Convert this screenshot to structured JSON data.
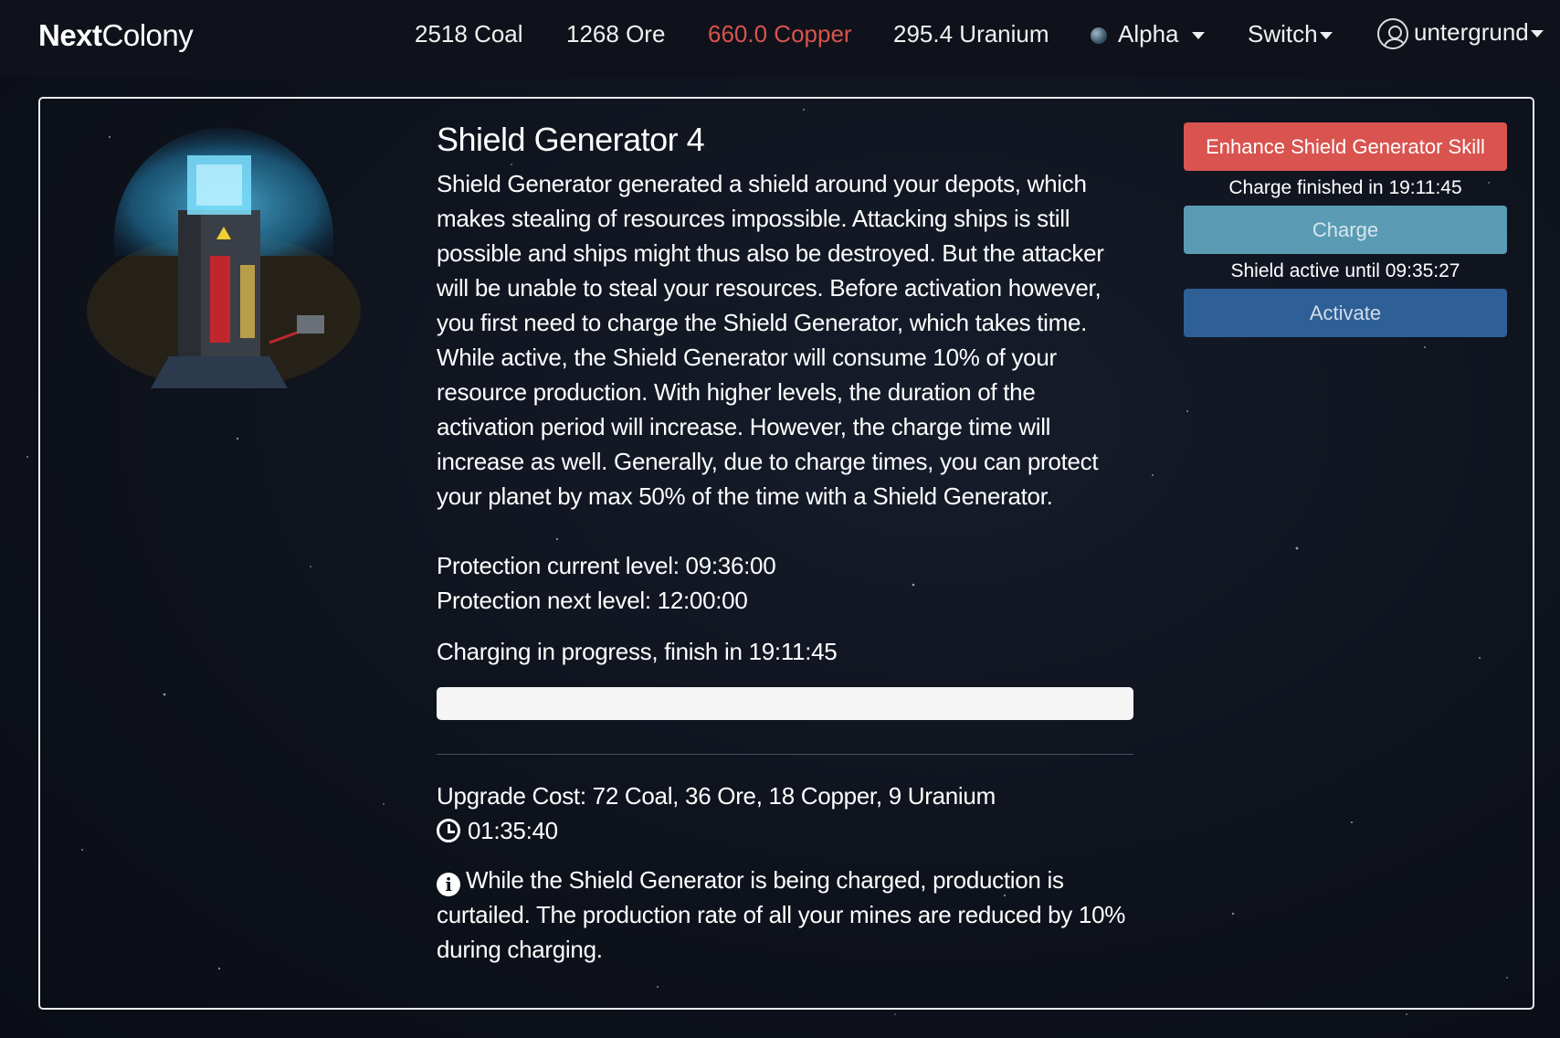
{
  "navbar": {
    "brand_bold": "Next",
    "brand_light": "Colony",
    "resources": {
      "coal": "2518 Coal",
      "ore": "1268 Ore",
      "copper": "660.0 Copper",
      "uranium": "295.4 Uranium"
    },
    "planet_label": "Alpha",
    "switch_label": "Switch",
    "user_label": "untergrund"
  },
  "colors": {
    "copper_text": "#d9534f",
    "enhance_button": "#d9534f",
    "charge_button": "#5a9bb3",
    "activate_button": "#2e5f96"
  },
  "building": {
    "title": "Shield Generator 4",
    "description": "Shield Generator generated a shield around your depots, which makes stealing of resources impossible. Attacking ships is still possible and ships might thus also be destroyed. But the attacker will be unable to steal your resources. Before activation however, you first need to charge the Shield Generator, which takes time. While active, the Shield Generator will consume 10% of your resource production. With higher levels, the duration of the activation period will increase. However, the charge time will increase as well. Generally, due to charge times, you can protect your planet by max 50% of the time with a Shield Generator.",
    "protection_current": "Protection current level: 09:36:00",
    "protection_next": "Protection next level: 12:00:00",
    "charging_status": "Charging in progress, finish in 19:11:45",
    "charge_progress_fraction": 0.0,
    "upgrade_cost": "Upgrade Cost: 72 Coal, 36 Ore, 18 Copper, 9 Uranium",
    "upgrade_time": "01:35:40",
    "info_note": "While the Shield Generator is being charged, production is curtailed. The production rate of all your mines are reduced by 10% during charging."
  },
  "actions": {
    "enhance_label": "Enhance Shield Generator Skill",
    "charge_status": "Charge finished in 19:11:45",
    "charge_label": "Charge",
    "shield_status": "Shield active until 09:35:27",
    "activate_label": "Activate"
  },
  "icons": [
    "planet-icon",
    "caret-down-icon",
    "user-avatar-icon",
    "clock-icon",
    "info-icon"
  ]
}
